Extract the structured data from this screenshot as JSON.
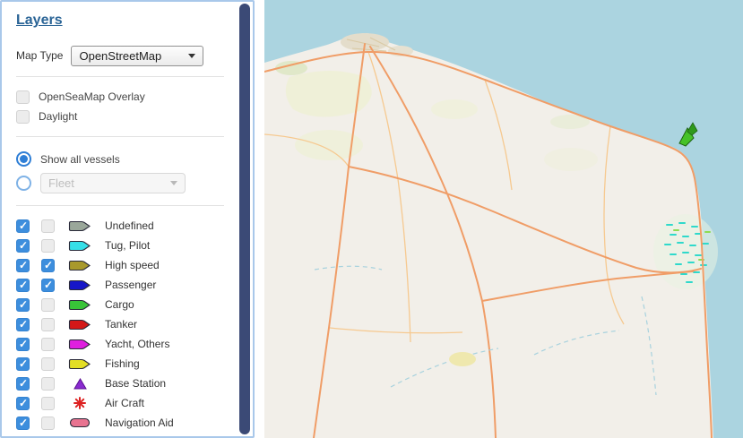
{
  "panel": {
    "title": "Layers",
    "map_type": {
      "label": "Map Type",
      "value": "OpenStreetMap"
    },
    "overlay_options": [
      {
        "label": "OpenSeaMap Overlay",
        "checked": false
      },
      {
        "label": "Daylight",
        "checked": false
      }
    ],
    "vessel_filter": {
      "show_all": {
        "label": "Show all vessels",
        "selected": true
      },
      "fleet": {
        "label": "Fleet",
        "selected": false,
        "enabled": false
      }
    },
    "vessel_types": [
      {
        "label": "Undefined",
        "icon": "ship",
        "color": "#9aa79a",
        "show": true,
        "highlight": false
      },
      {
        "label": "Tug, Pilot",
        "icon": "ship",
        "color": "#35dfe8",
        "show": true,
        "highlight": false
      },
      {
        "label": "High speed",
        "icon": "ship",
        "color": "#a8992c",
        "show": true,
        "highlight": true
      },
      {
        "label": "Passenger",
        "icon": "ship",
        "color": "#1616c8",
        "show": true,
        "highlight": true
      },
      {
        "label": "Cargo",
        "icon": "ship",
        "color": "#38c438",
        "show": true,
        "highlight": false
      },
      {
        "label": "Tanker",
        "icon": "ship",
        "color": "#d41818",
        "show": true,
        "highlight": false
      },
      {
        "label": "Yacht, Others",
        "icon": "ship",
        "color": "#df1fdf",
        "show": true,
        "highlight": false
      },
      {
        "label": "Fishing",
        "icon": "ship",
        "color": "#e3de25",
        "show": true,
        "highlight": false
      },
      {
        "label": "Base Station",
        "icon": "triangle",
        "color": "#8a2bd0",
        "show": true,
        "highlight": false
      },
      {
        "label": "Air Craft",
        "icon": "asterisk",
        "color": "#dd2222",
        "show": true,
        "highlight": false
      },
      {
        "label": "Navigation Aid",
        "icon": "pill",
        "color": "#e87390",
        "show": true,
        "highlight": false
      }
    ]
  },
  "colors": {
    "accent_blue": "#3d8edd",
    "scrollbar": "#3b4a76",
    "water": "#abd4e0",
    "land": "#f2efe9",
    "vessel_marker_green": "#46c228"
  }
}
